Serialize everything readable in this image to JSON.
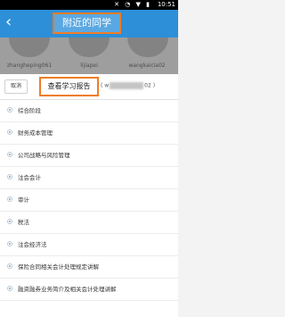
{
  "status": {
    "time": "10:51",
    "icons": "✕ ◔ ▼ ▮"
  },
  "header": {
    "title": "附近的同学",
    "back": "‹"
  },
  "nearby_users": [
    {
      "name": "zhangheping061"
    },
    {
      "name": "lijiapei"
    },
    {
      "name": "wangkaicia02"
    }
  ],
  "sheet": {
    "cancel": "取消",
    "view_report": "查看学习报告",
    "report_user_prefix": "( w",
    "report_user_suffix": "02 )"
  },
  "courses": [
    {
      "label": "综合阶段"
    },
    {
      "label": "财务成本管理"
    },
    {
      "label": "公司战略与风险管理"
    },
    {
      "label": "注会会计"
    },
    {
      "label": "审计"
    },
    {
      "label": "税法"
    },
    {
      "label": "注会经济法"
    },
    {
      "label": "保险合同相关会计处理规定讲解"
    },
    {
      "label": "融资融券业务简介及相关会计处理讲解"
    }
  ]
}
